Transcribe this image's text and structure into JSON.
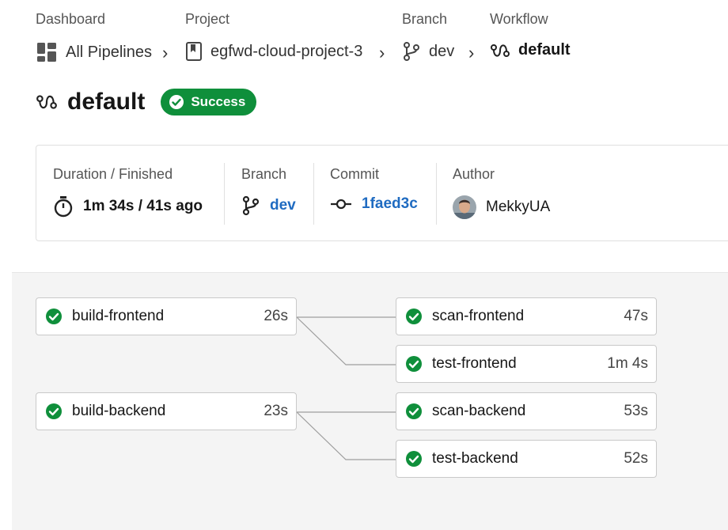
{
  "breadcrumb": {
    "dashboard": {
      "label": "Dashboard",
      "value": "All Pipelines"
    },
    "project": {
      "label": "Project",
      "value": "egfwd-cloud-project-3"
    },
    "branch": {
      "label": "Branch",
      "value": "dev"
    },
    "workflow": {
      "label": "Workflow",
      "value": "default"
    }
  },
  "header": {
    "title": "default",
    "status": "Success"
  },
  "info": {
    "duration": {
      "label": "Duration / Finished",
      "value": "1m 34s / 41s ago"
    },
    "branch": {
      "label": "Branch",
      "value": "dev"
    },
    "commit": {
      "label": "Commit",
      "value": "1faed3c"
    },
    "author": {
      "label": "Author",
      "value": "MekkyUA"
    }
  },
  "jobs": [
    {
      "name": "build-frontend",
      "duration": "26s"
    },
    {
      "name": "scan-frontend",
      "duration": "47s"
    },
    {
      "name": "test-frontend",
      "duration": "1m 4s"
    },
    {
      "name": "build-backend",
      "duration": "23s"
    },
    {
      "name": "scan-backend",
      "duration": "53s"
    },
    {
      "name": "test-backend",
      "duration": "52s"
    }
  ],
  "colors": {
    "success": "#0f8f3b",
    "link": "#1f6bc1"
  }
}
